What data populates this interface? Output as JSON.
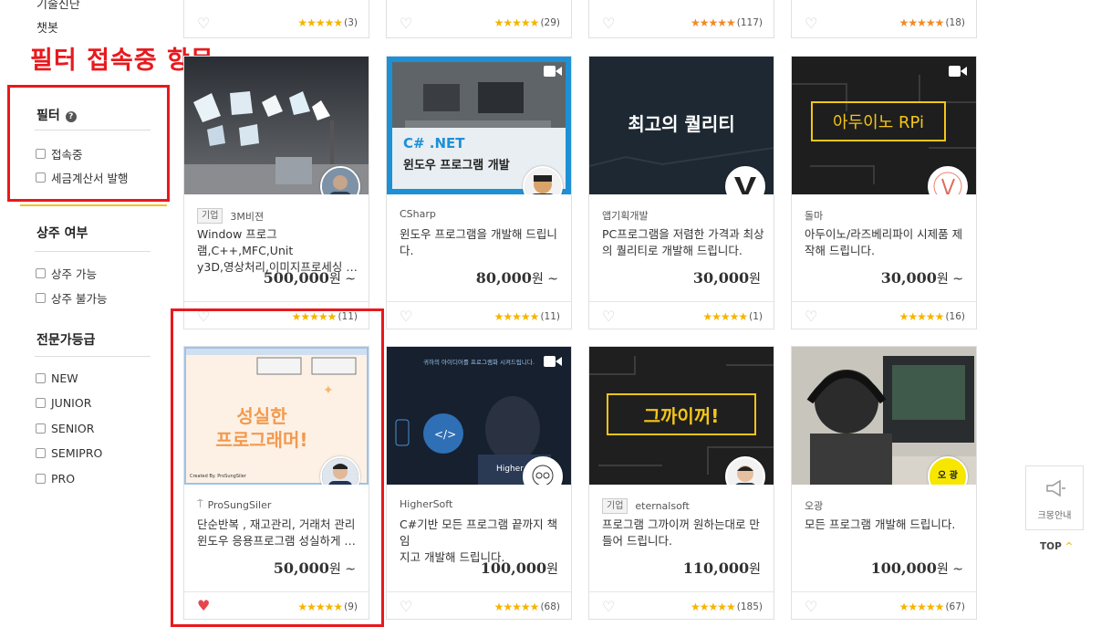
{
  "annotation": {
    "title": "필터 접속중 항목"
  },
  "sidebar": {
    "top_partial_label": "기술신단",
    "top_item": "챗봇",
    "filter": {
      "title": "필터",
      "help_symbol": "?",
      "options": [
        "접속중",
        "세금계산서 발행"
      ]
    },
    "residency": {
      "title": "상주 여부",
      "options": [
        "상주 가능",
        "상주 불가능"
      ]
    },
    "expert_level": {
      "title": "전문가등급",
      "options": [
        "NEW",
        "JUNIOR",
        "SENIOR",
        "SEMIPRO",
        "PRO"
      ]
    }
  },
  "top_row": [
    {
      "stars": "★★★★★",
      "count": "(3)"
    },
    {
      "stars": "★★★★★",
      "count": "(29)"
    },
    {
      "stars": "★★★★★",
      "count": "(117)"
    },
    {
      "stars": "★★★★★",
      "count": "(18)"
    }
  ],
  "cards": [
    {
      "seller_badge": "기업",
      "seller": "3M비젼",
      "desc_line1": "Window 프로그램,C++,MFC,Unit",
      "desc_line2": "y3D,영상처리,이미지프로세싱 …",
      "price": "500,000",
      "unit": "원 ~",
      "stars": "★★★★★",
      "count": "(11)"
    },
    {
      "seller": "CSharp",
      "thumb_line1": "C# .NET",
      "thumb_line2": "윈도우 프로그램 개발",
      "desc_line1": "윈도우 프로그램을 개발해 드립니",
      "desc_line2": "다.",
      "price": "80,000",
      "unit": "원 ~",
      "stars": "★★★★★",
      "count": "(11)"
    },
    {
      "seller": "앱기획개발",
      "thumb_text": "최고의 퀄리티",
      "desc_line1": "PC프로그램을 저렴한 가격과 최상",
      "desc_line2": "의 퀄리티로 개발해 드립니다.",
      "price": "30,000",
      "unit": "원",
      "stars": "★★★★★",
      "count": "(1)"
    },
    {
      "seller": "돌마",
      "thumb_text": "아두이노 RPi",
      "desc_line1": "아두이노/라즈베리파이 시제품 제",
      "desc_line2": "작해 드립니다.",
      "price": "30,000",
      "unit": "원 ~",
      "stars": "★★★★★",
      "count": "(16)"
    },
    {
      "seller": "ProSungSiler",
      "thumb_line1": "성실한",
      "thumb_line2": "프로그래머!",
      "thumb_footer": "Created By. ProSungSiler",
      "desc_line1": "단순반복 , 재고관리, 거래처 관리",
      "desc_line2": "윈도우 응용프로그램 성실하게 …",
      "price": "50,000",
      "unit": "원 ~",
      "stars": "★★★★★",
      "count": "(9)"
    },
    {
      "seller": "HigherSoft",
      "thumb_text": "귀하의 아이디어를 프로그램화 시켜드립니다.",
      "thumb_label": "Higher S",
      "desc_line1": "C#기반 모든 프로그램 끝까지 책임",
      "desc_line2": "지고 개발해 드립니다.",
      "price": "100,000",
      "unit": "원",
      "stars": "★★★★★",
      "count": "(68)"
    },
    {
      "seller_badge": "기업",
      "seller": "eternalsoft",
      "thumb_text": "그까이꺼!",
      "desc_line1": "프로그램 그까이꺼 원하는대로 만",
      "desc_line2": "들어 드립니다.",
      "price": "110,000",
      "unit": "원",
      "stars": "★★★★★",
      "count": "(185)"
    },
    {
      "seller": "오광",
      "avatar_text": "오 광",
      "desc_line1": "모든 프로그램 개발해 드립니다.",
      "desc_line2": "",
      "price": "100,000",
      "unit": "원 ~",
      "stars": "★★★★★",
      "count": "(67)"
    }
  ],
  "floating": {
    "guide_label": "크몽안내",
    "top_label": "TOP",
    "top_arrow": "^"
  },
  "colors": {
    "accent_red": "#e8191d",
    "star_yellow": "#f5b400",
    "brand_yellow": "#f0c419",
    "heart_red": "#e5474f"
  }
}
